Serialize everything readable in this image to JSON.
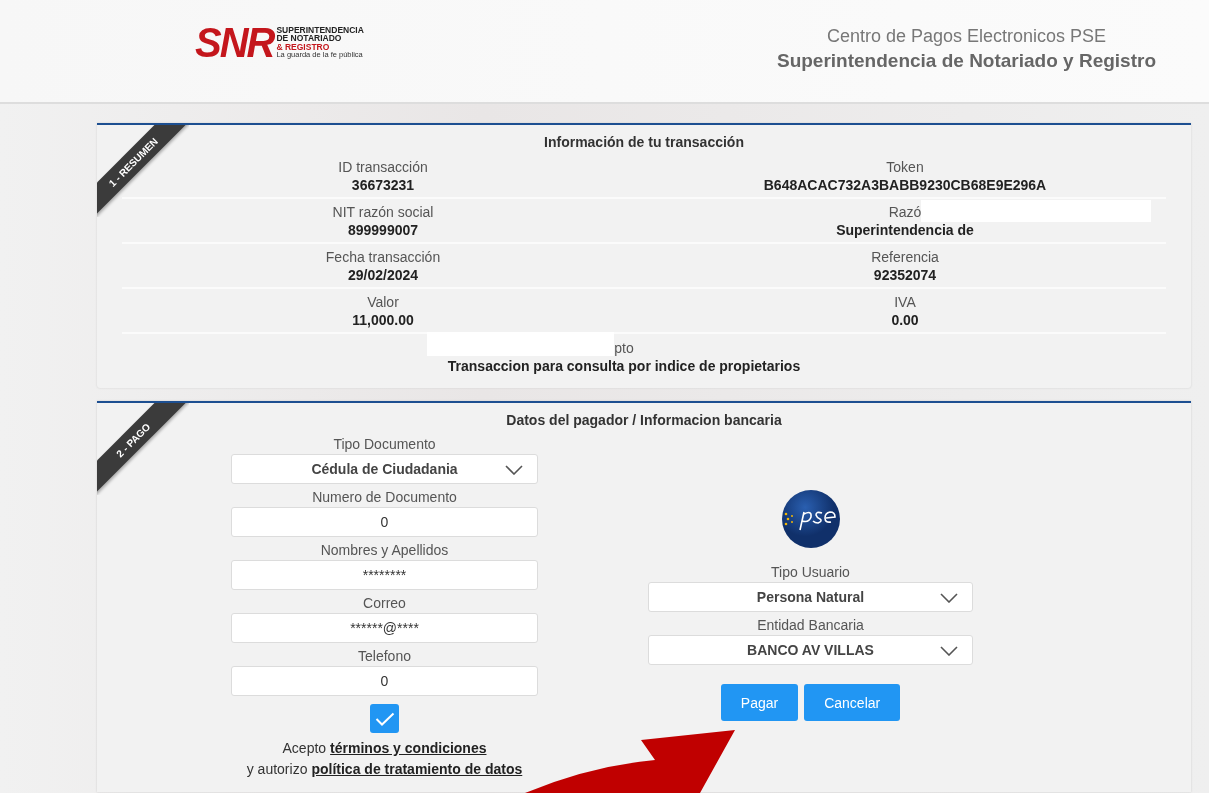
{
  "header": {
    "logo": {
      "acronym": "SNR",
      "lines": [
        "SUPERINTENDENCIA",
        "DE NOTARIADO",
        "& REGISTRO"
      ],
      "tagline": "La guarda de la fe pública"
    },
    "subtitle": "Centro de Pagos Electronicos PSE",
    "title": "Superintendencia de Notariado y Registro"
  },
  "summary": {
    "ribbon": "1 - RESUMEN",
    "title": "Información de tu transacción",
    "rows": [
      {
        "cells": [
          {
            "label": "ID transacción",
            "value": "36673231",
            "redacted": false
          },
          {
            "label": "Token",
            "value": "B648ACAC732A3BABB9230CB68E9E296A",
            "redacted": false
          }
        ]
      },
      {
        "cells": [
          {
            "label": "NIT razón social",
            "value": "899999007",
            "redacted": false
          },
          {
            "label": "Razó",
            "value": "Superintendencia de",
            "redacted": true
          }
        ]
      },
      {
        "cells": [
          {
            "label": "Fecha transacción",
            "value": "29/02/2024",
            "redacted": false
          },
          {
            "label": "Referencia",
            "value": "92352074",
            "redacted": false
          }
        ]
      },
      {
        "cells": [
          {
            "label": "Valor",
            "value": "11,000.00",
            "redacted": false
          },
          {
            "label": "IVA",
            "value": "0.00",
            "redacted": false
          }
        ]
      }
    ],
    "concept": {
      "label": "pto",
      "value": "Transaccion para consulta por indice de propietarios",
      "redacted": true
    }
  },
  "payment": {
    "ribbon": "2 - PAGO",
    "title": "Datos del pagador / Informacion bancaria",
    "payer_fields": [
      {
        "kind": "select",
        "label": "Tipo Documento",
        "value": "Cédula de Ciudadania"
      },
      {
        "kind": "input",
        "label": "Numero de Documento",
        "value": "0"
      },
      {
        "kind": "input",
        "label": "Nombres y Apellidos",
        "value": "********"
      },
      {
        "kind": "input",
        "label": "Correo",
        "value": "******@****"
      },
      {
        "kind": "input",
        "label": "Telefono",
        "value": "0"
      }
    ],
    "accept": {
      "checked": true,
      "lines": [
        {
          "text": "Acepto",
          "link": "términos y condiciones"
        },
        {
          "text": "y autorizo",
          "link": "política de tratamiento de datos"
        }
      ]
    },
    "bank_fields": [
      {
        "kind": "select",
        "label": "Tipo Usuario",
        "value": "Persona Natural"
      },
      {
        "kind": "select",
        "label": "Entidad Bancaria",
        "value": "BANCO AV VILLAS"
      }
    ],
    "buttons": [
      "Pagar",
      "Cancelar"
    ]
  }
}
